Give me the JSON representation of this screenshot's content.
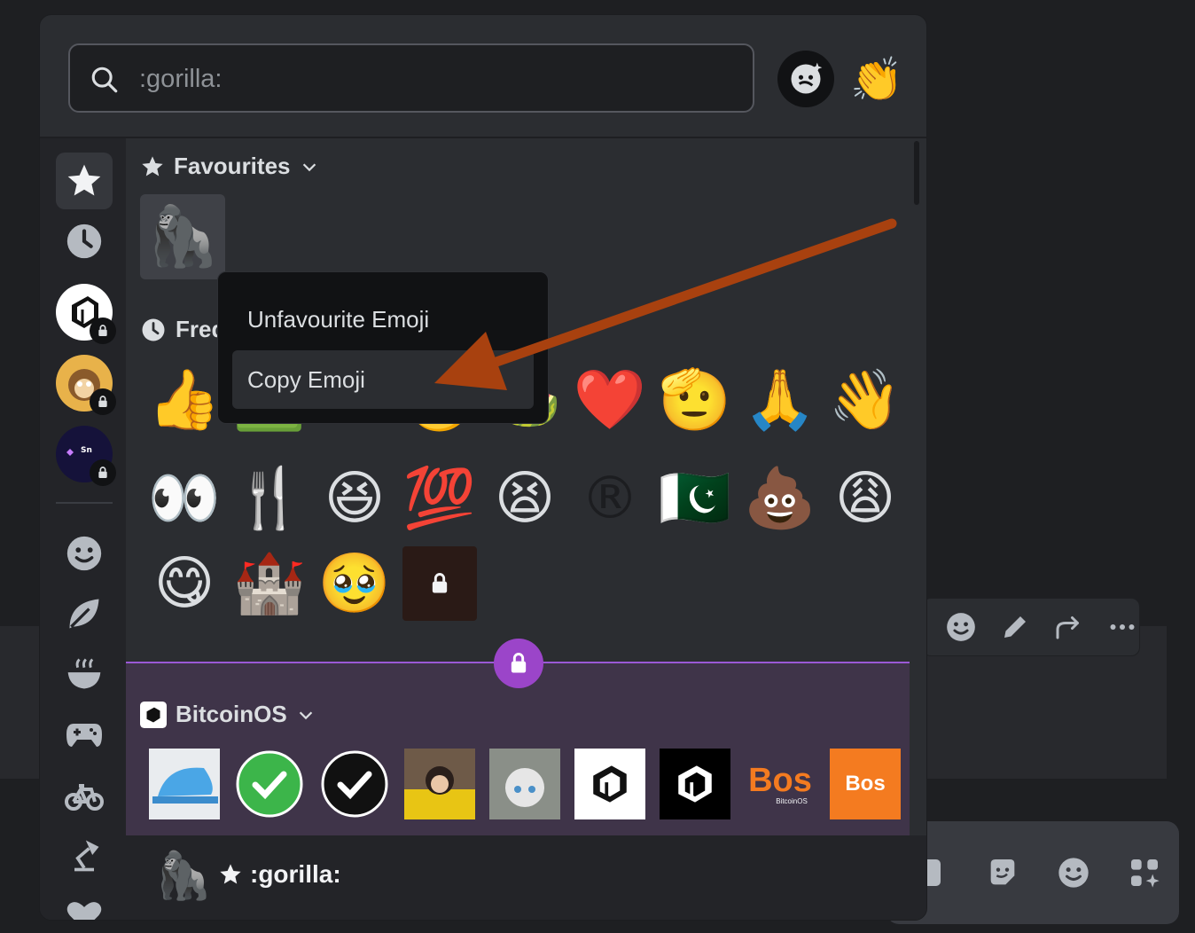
{
  "search": {
    "placeholder": ":gorilla:"
  },
  "header": {
    "nitro_icon": "nitro-emoji-icon",
    "skin_tone_emoji": "👏"
  },
  "sidebar": {
    "items": [
      {
        "name": "favourites",
        "icon": "star-icon"
      },
      {
        "name": "recent",
        "icon": "clock-icon"
      },
      {
        "name": "server-bitcoinos",
        "icon": "bitcoinos-server-icon"
      },
      {
        "name": "server-monkey",
        "icon": "monkey-server-icon"
      },
      {
        "name": "server-sn",
        "icon": "sn-server-icon",
        "label": "Sn"
      },
      {
        "name": "people",
        "icon": "smile-icon"
      },
      {
        "name": "nature",
        "icon": "leaf-icon"
      },
      {
        "name": "food",
        "icon": "bowl-icon"
      },
      {
        "name": "activities",
        "icon": "gamepad-icon"
      },
      {
        "name": "travel",
        "icon": "bicycle-icon"
      },
      {
        "name": "objects",
        "icon": "lamp-icon"
      },
      {
        "name": "symbols",
        "icon": "heart-icon"
      }
    ]
  },
  "sections": {
    "favourites": {
      "title": "Favourites",
      "emoji": [
        "🦍"
      ]
    },
    "frequent": {
      "title_visible": "Freq",
      "row1": [
        "👍",
        "🟩",
        "⚫",
        "🟡",
        "🍉",
        "❤️",
        "🫡",
        "🙏",
        "👋"
      ],
      "row2": [
        "👀",
        "🍴",
        "😆",
        "💯",
        "😫",
        "®",
        "🇵🇰",
        "💩",
        "😩"
      ],
      "row3": [
        "😋",
        "🏰",
        "🥹",
        "locked"
      ]
    },
    "bitcoinos": {
      "title": "BitcoinOS",
      "bos_text": "Bos",
      "bos_sub": "BitcoinOS"
    }
  },
  "context_menu": {
    "items": [
      {
        "label": "Unfavourite Emoji"
      },
      {
        "label": "Copy Emoji"
      }
    ]
  },
  "footer": {
    "emoji": "🦍",
    "name": ":gorilla:"
  },
  "colors": {
    "accent_premium": "#9b45c9",
    "arrow": "#b0450f"
  }
}
